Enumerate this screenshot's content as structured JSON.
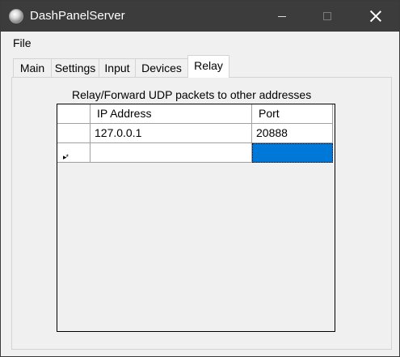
{
  "window": {
    "title": "DashPanelServer"
  },
  "menu": {
    "file_label": "File"
  },
  "tabs": [
    {
      "label": "Main"
    },
    {
      "label": "Settings"
    },
    {
      "label": "Input"
    },
    {
      "label": "Devices"
    },
    {
      "label": "Relay",
      "active": true
    }
  ],
  "relay": {
    "description": "Relay/Forward UDP packets to other addresses",
    "columns": [
      "IP Address",
      "Port"
    ],
    "rows": [
      {
        "ip": "127.0.0.1",
        "port": "20888"
      },
      {
        "ip": "",
        "port": ""
      }
    ],
    "new_row_marker": "▸*"
  },
  "colors": {
    "titlebar": "#3c3c3c",
    "selection": "#0078d7",
    "background": "#f0f0f0"
  },
  "icons": [
    "app-icon",
    "minimize-icon",
    "maximize-icon",
    "close-icon"
  ]
}
